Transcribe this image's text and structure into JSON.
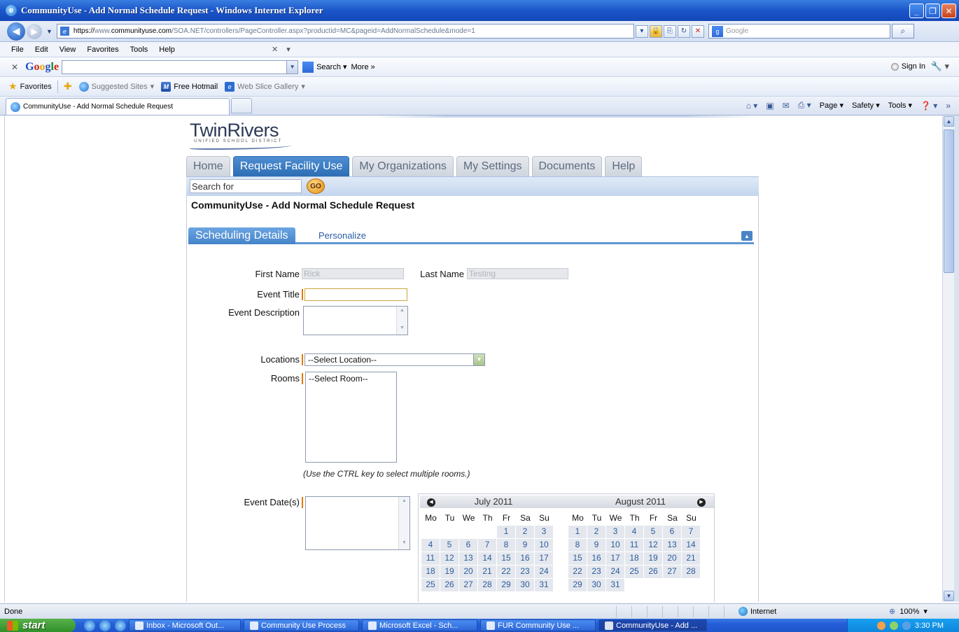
{
  "window": {
    "title": "CommunityUse - Add Normal Schedule Request - Windows Internet Explorer"
  },
  "address": {
    "scheme": "https://",
    "host_pre": "www.",
    "host": "communityuse.com",
    "path": "/SOA.NET/controllers/PageController.aspx?productid=MC&pageid=AddNormalSchedule&mode=1",
    "search_placeholder": "Google"
  },
  "menu": [
    "File",
    "Edit",
    "View",
    "Favorites",
    "Tools",
    "Help"
  ],
  "google_toolbar": {
    "logo": [
      "G",
      "o",
      "o",
      "g",
      "l",
      "e"
    ],
    "search_label": "Search",
    "more_label": "More »",
    "signin_label": "Sign In"
  },
  "favorites_bar": {
    "favorites_label": "Favorites",
    "items": [
      "Suggested Sites",
      "Free Hotmail",
      "Web Slice Gallery"
    ]
  },
  "tab": {
    "title": "CommunityUse - Add Normal Schedule Request"
  },
  "command_bar": [
    "Page",
    "Safety",
    "Tools"
  ],
  "site": {
    "logo_main": "TwinRivers",
    "logo_sub": "UNIFIED SCHOOL DISTRICT",
    "nav": [
      "Home",
      "Request Facility Use",
      "My Organizations",
      "My Settings",
      "Documents",
      "Help"
    ],
    "active_nav": "Request Facility Use",
    "search_value": "Search for",
    "go_label": "GO",
    "page_title": "CommunityUse - Add Normal Schedule Request"
  },
  "section": {
    "tab_label": "Scheduling Details",
    "link_label": "Personalize"
  },
  "form": {
    "first_name_label": "First Name",
    "first_name_value": "Rick",
    "last_name_label": "Last Name",
    "last_name_value": "Testing",
    "event_title_label": "Event Title",
    "event_description_label": "Event Description",
    "locations_label": "Locations",
    "locations_selected": "--Select Location--",
    "rooms_label": "Rooms",
    "rooms_option": "--Select Room--",
    "rooms_note": "(Use the CTRL key to select multiple rooms.)",
    "event_dates_label": "Event Date(s)"
  },
  "calendar": {
    "dow": [
      "Mo",
      "Tu",
      "We",
      "Th",
      "Fr",
      "Sa",
      "Su"
    ],
    "months": [
      {
        "label": "July 2011",
        "offset": 4,
        "days": 31
      },
      {
        "label": "August  2011",
        "offset": 0,
        "days": 31
      }
    ]
  },
  "status": {
    "text": "Done",
    "zone": "Internet",
    "zoom": "100%"
  },
  "taskbar": {
    "start_label": "start",
    "items": [
      "Inbox - Microsoft Out...",
      "Community Use Process",
      "Microsoft Excel - Sch...",
      "FUR Community Use ...",
      "CommunityUse - Add ..."
    ],
    "clock": "3:30 PM"
  }
}
